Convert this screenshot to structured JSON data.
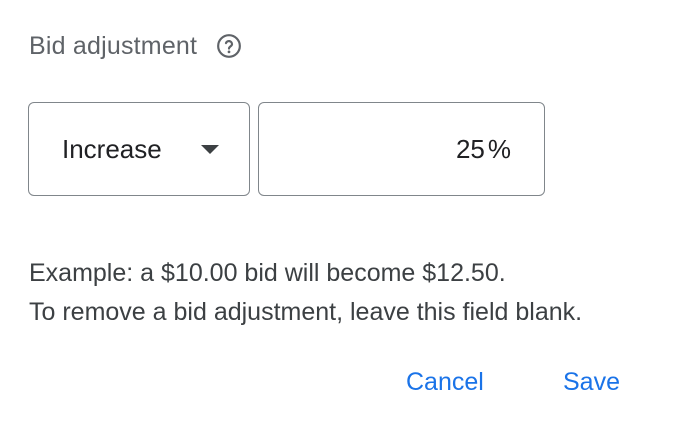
{
  "bid_adjustment": {
    "label": "Bid adjustment",
    "help_icon": "help-circle-icon"
  },
  "direction_select": {
    "selected": "Increase",
    "caret_icon": "caret-down-icon"
  },
  "amount_field": {
    "value": "25",
    "suffix": "%"
  },
  "help_text": {
    "line1": "Example: a $10.00 bid will become $12.50.",
    "line2": "To remove a bid adjustment, leave this field blank."
  },
  "actions": {
    "cancel_label": "Cancel",
    "save_label": "Save"
  },
  "colors": {
    "accent": "#1a73e8",
    "border": "#80868b",
    "muted_text": "#5f6368",
    "body_text": "#202124"
  }
}
